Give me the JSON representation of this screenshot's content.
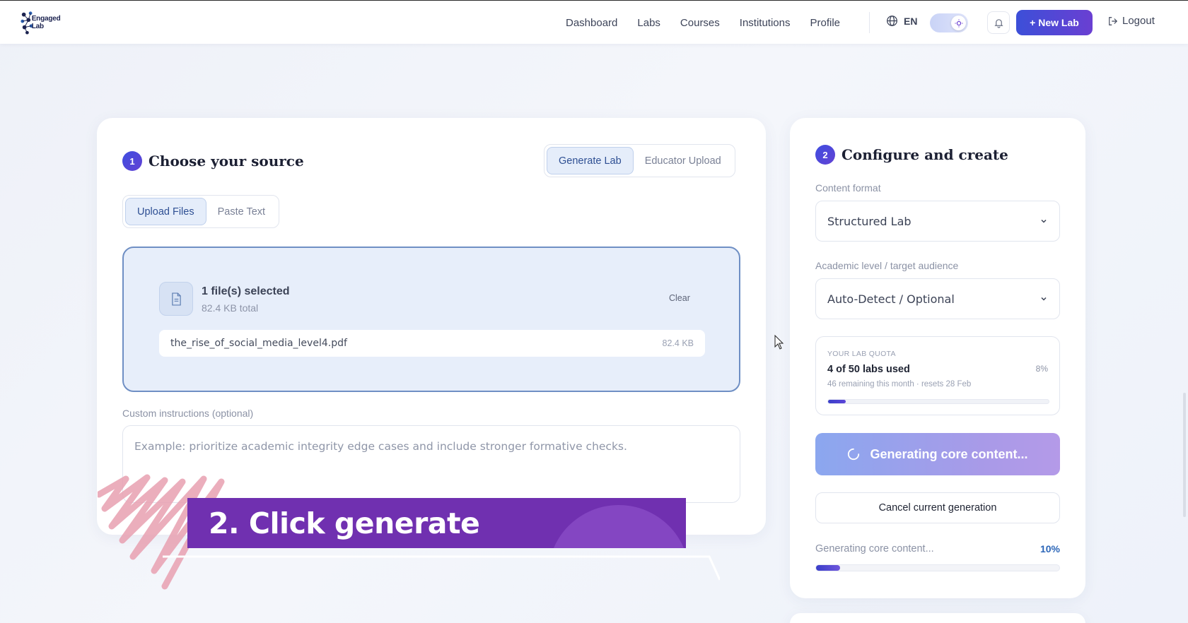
{
  "nav": {
    "brand": "Engaged Lab",
    "links": [
      "Dashboard",
      "Labs",
      "Courses",
      "Institutions",
      "Profile"
    ],
    "language": "EN",
    "new_lab": "+ New Lab",
    "logout": "Logout",
    "icons": {
      "language": "globe-icon",
      "theme": "sun-icon",
      "notifications": "bell-icon",
      "logout": "logout-icon"
    }
  },
  "source": {
    "step": "1",
    "title": "Choose your source",
    "mode_tabs": [
      "Generate Lab",
      "Educator Upload"
    ],
    "mode_active": "Generate Lab",
    "input_tabs": [
      "Upload Files",
      "Paste Text"
    ],
    "input_active": "Upload Files",
    "selection": {
      "count_text": "1 file(s) selected",
      "total_text": "82.4 KB total",
      "clear": "Clear",
      "files": [
        {
          "name": "the_rise_of_social_media_level4.pdf",
          "size": "82.4 KB"
        }
      ]
    },
    "custom_label": "Custom instructions (optional)",
    "custom_placeholder": "Example: prioritize academic integrity edge cases and include stronger formative checks."
  },
  "configure": {
    "step": "2",
    "title": "Configure and create",
    "format_label": "Content format",
    "format_value": "Structured Lab",
    "level_label": "Academic level / target audience",
    "level_value": "Auto-Detect / Optional",
    "quota": {
      "eyebrow": "YOUR LAB QUOTA",
      "title": "4 of 50 labs used",
      "subtitle": "46 remaining this month · resets 28 Feb",
      "percent_text": "8%",
      "fraction": 0.08
    },
    "generate_button": "Generating core content...",
    "cancel_button": "Cancel current generation",
    "progress": {
      "label": "Generating core content...",
      "percent_text": "10%",
      "fraction": 0.1
    }
  },
  "overlay": {
    "caption": "2. Click generate"
  },
  "colors": {
    "accent": "#4a4fd8",
    "caption_bg": "#7030b0",
    "dropzone_border": "#6f8fc4"
  }
}
